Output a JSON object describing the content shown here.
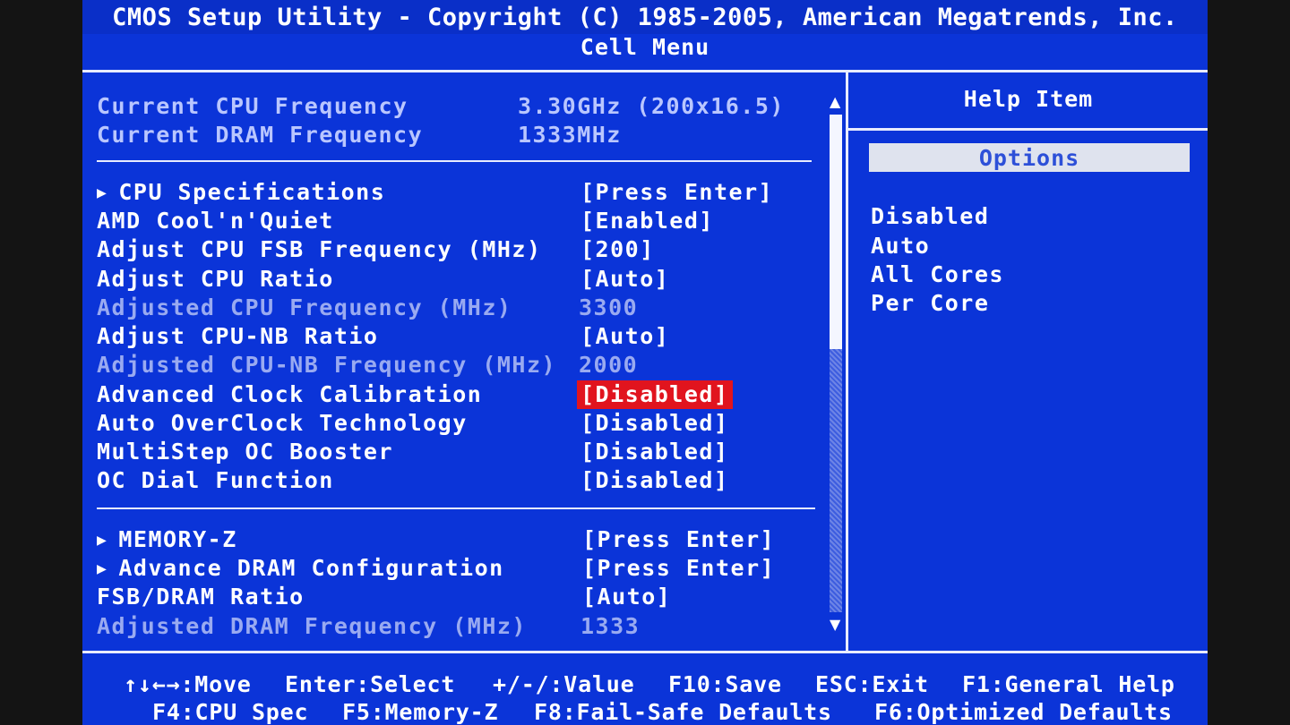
{
  "header": {
    "title": "CMOS Setup Utility - Copyright (C) 1985-2005, American Megatrends, Inc.",
    "subtitle": "Cell Menu"
  },
  "info": [
    {
      "label": "Current CPU Frequency",
      "value": "3.30GHz (200x16.5)"
    },
    {
      "label": "Current DRAM Frequency",
      "value": "1333MHz"
    }
  ],
  "cpu_items": [
    {
      "label": "CPU Specifications",
      "value": "[Press Enter]",
      "submenu": true
    },
    {
      "label": "AMD Cool'n'Quiet",
      "value": "[Enabled]"
    },
    {
      "label": "Adjust CPU FSB Frequency (MHz)",
      "value": "[200]"
    },
    {
      "label": "Adjust CPU Ratio",
      "value": "[Auto]"
    },
    {
      "label": "Adjusted CPU Frequency (MHz)",
      "value": "3300",
      "readonly": true
    },
    {
      "label": "Adjust CPU-NB Ratio",
      "value": "[Auto]"
    },
    {
      "label": "Adjusted CPU-NB Frequency (MHz)",
      "value": "2000",
      "readonly": true
    },
    {
      "label": "Advanced Clock Calibration",
      "value": "[Disabled]",
      "selected": true
    },
    {
      "label": "Auto OverClock Technology",
      "value": "[Disabled]"
    },
    {
      "label": "MultiStep OC Booster",
      "value": "[Disabled]"
    },
    {
      "label": "OC Dial Function",
      "value": "[Disabled]"
    }
  ],
  "memory_items": [
    {
      "label": "MEMORY-Z",
      "value": "[Press Enter]",
      "submenu": true
    },
    {
      "label": "Advance DRAM Configuration",
      "value": "[Press Enter]",
      "submenu": true
    },
    {
      "label": "FSB/DRAM Ratio",
      "value": "[Auto]"
    },
    {
      "label": "Adjusted DRAM Frequency (MHz)",
      "value": "1333",
      "readonly": true
    }
  ],
  "submenu_glyph": "▶",
  "scroll": {
    "up": "▲",
    "down": "▼"
  },
  "help": {
    "title": "Help Item",
    "options_header": "Options",
    "options": [
      "Disabled",
      "Auto",
      "All Cores",
      "Per Core"
    ]
  },
  "footer": {
    "row1": [
      "↑↓←→:Move",
      "Enter:Select",
      "+/-/:Value",
      "F10:Save",
      "ESC:Exit",
      "F1:General Help"
    ],
    "row2": [
      "F4:CPU Spec",
      "F5:Memory-Z",
      "F8:Fail-Safe Defaults",
      "F6:Optimized Defaults"
    ]
  },
  "colors": {
    "background": "#0b34d8",
    "selected": "#e1141e",
    "text": "#ffffff",
    "disabled_text": "#b2bff6"
  }
}
